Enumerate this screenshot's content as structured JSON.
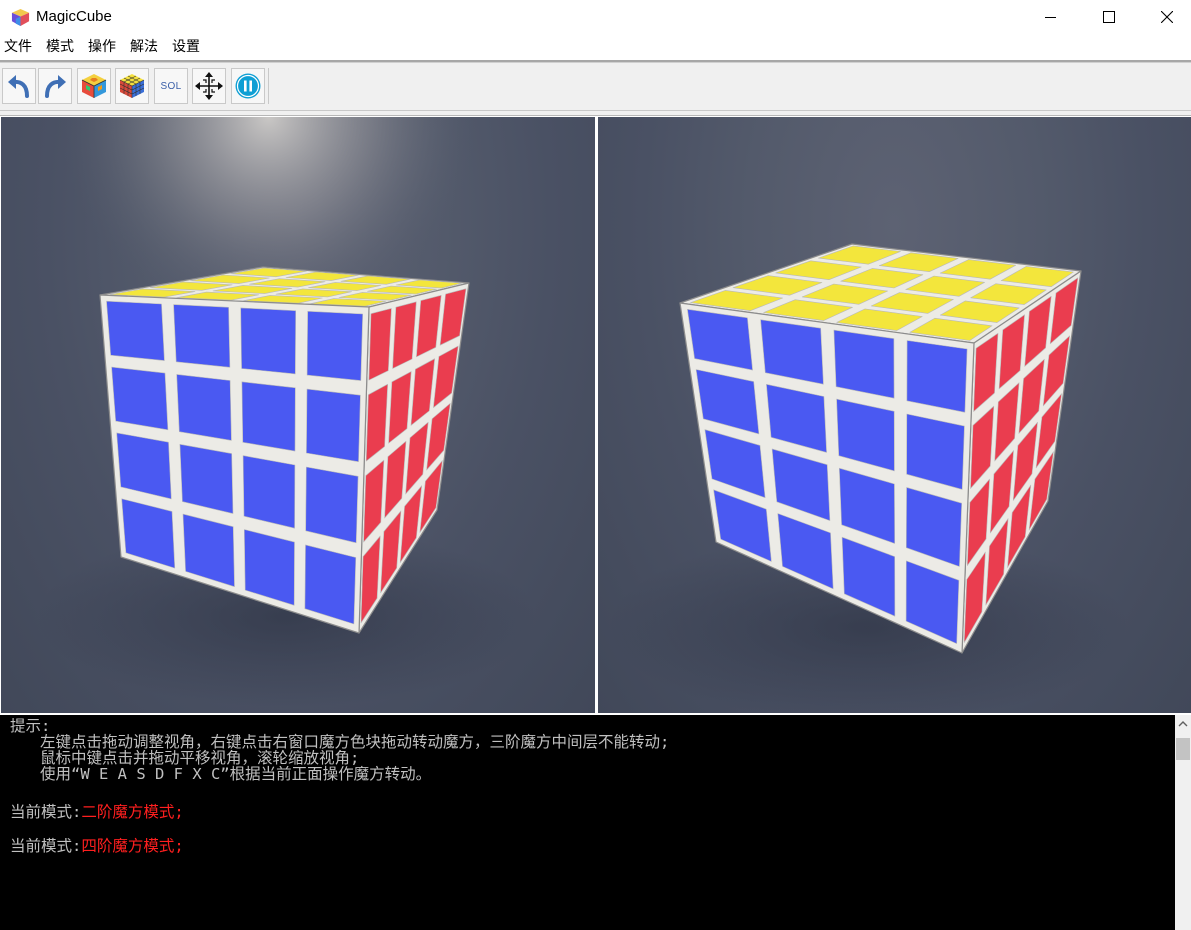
{
  "window": {
    "title": "MagicCube",
    "app_icon": "cube-logo-icon",
    "controls": [
      "minimize-icon",
      "maximize-icon",
      "close-icon"
    ]
  },
  "menu": [
    "文件",
    "模式",
    "操作",
    "解法",
    "设置"
  ],
  "toolbar": {
    "buttons": [
      {
        "name": "undo-button",
        "icon": "undo-arrow-icon"
      },
      {
        "name": "redo-button",
        "icon": "redo-arrow-icon"
      },
      {
        "name": "scramble-button",
        "icon": "colorful-cube-icon"
      },
      {
        "name": "reset-cube-button",
        "icon": "solved-cube-icon"
      },
      {
        "name": "solve-button",
        "icon": "sol-text-icon",
        "label": "SOL"
      },
      {
        "name": "pan-view-button",
        "icon": "move-arrows-icon"
      },
      {
        "name": "pause-button",
        "icon": "pause-circle-icon"
      }
    ]
  },
  "viewports": {
    "left": {
      "cube_order": 4,
      "face_colors": {
        "front": "#4a59f2",
        "top": "#f3e63c",
        "right": "#ea3d4f"
      }
    },
    "right": {
      "cube_order": 4,
      "face_colors": {
        "front": "#4a59f2",
        "top": "#f3e63c",
        "right": "#ea3d4f"
      }
    }
  },
  "console": {
    "hint_title": "提示:",
    "hint_lines": [
      "左键点击拖动调整视角，右键点击右窗口魔方色块拖动转动魔方，三阶魔方中间层不能转动;",
      "鼠标中键点击并拖动平移视角，滚轮缩放视角;",
      "使用“W E A S D F X C”根据当前正面操作魔方转动。"
    ],
    "mode_prefix": "当前模式:",
    "modes": [
      "二阶魔方模式;",
      "四阶魔方模式;"
    ],
    "text_color": "#c0c0c0",
    "mode_color": "#ff1f1f"
  }
}
